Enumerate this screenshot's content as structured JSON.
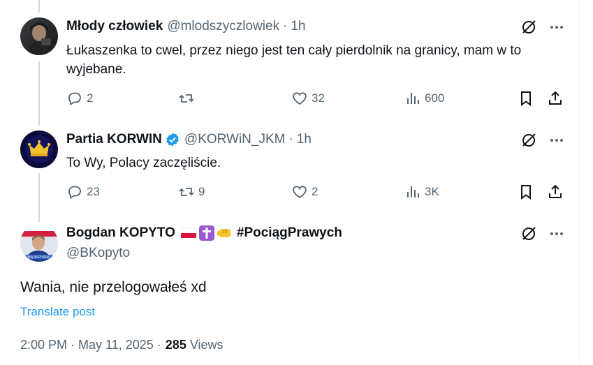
{
  "posts": [
    {
      "name": "Młody człowiek",
      "handle": "@mlodszyczlowiek",
      "dot": "·",
      "time": "1h",
      "text": "Łukaszenka to cwel, przez niego jest ten cały pierdolnik na granicy, mam w to wyjebane.",
      "replies": "2",
      "reposts": "",
      "likes": "32",
      "views": "600"
    },
    {
      "name": "Partia KORWIN",
      "handle": "@KORWiN_JKM",
      "dot": "·",
      "time": "1h",
      "text": "To Wy, Polacy zaczęliście.",
      "replies": "23",
      "reposts": "9",
      "likes": "2",
      "views": "3K"
    }
  ],
  "main": {
    "name": "Bogdan KOPYTO",
    "hashtag": "#PociągPrawych",
    "handle": "@BKopyto",
    "text": "Wania, nie przelogowałeś xd",
    "translate": "Translate post",
    "timestamp": "2:00 PM · May 11, 2025 ·",
    "views_count": "285",
    "views_label": "Views"
  },
  "colors": {
    "text": "#0f1419",
    "secondary": "#536471",
    "link": "#1d9bf0",
    "thread": "#cfd9de",
    "verified": "#1d9bf0"
  },
  "icons": [
    "grok-icon",
    "more-icon",
    "reply-icon",
    "repost-icon",
    "like-icon",
    "views-icon",
    "bookmark-icon",
    "share-icon",
    "verified-badge-icon",
    "poland-flag-emoji",
    "latin-cross-emoji",
    "oncoming-fist-emoji"
  ]
}
